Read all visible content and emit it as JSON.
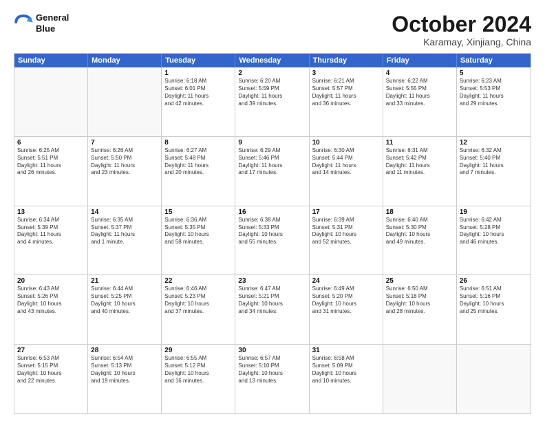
{
  "logo": {
    "line1": "General",
    "line2": "Blue"
  },
  "title": "October 2024",
  "subtitle": "Karamay, Xinjiang, China",
  "header": {
    "days": [
      "Sunday",
      "Monday",
      "Tuesday",
      "Wednesday",
      "Thursday",
      "Friday",
      "Saturday"
    ]
  },
  "rows": [
    [
      {
        "day": "",
        "empty": true
      },
      {
        "day": "",
        "empty": true
      },
      {
        "day": "1",
        "lines": [
          "Sunrise: 6:18 AM",
          "Sunset: 6:01 PM",
          "Daylight: 11 hours",
          "and 42 minutes."
        ]
      },
      {
        "day": "2",
        "lines": [
          "Sunrise: 6:20 AM",
          "Sunset: 5:59 PM",
          "Daylight: 11 hours",
          "and 39 minutes."
        ]
      },
      {
        "day": "3",
        "lines": [
          "Sunrise: 6:21 AM",
          "Sunset: 5:57 PM",
          "Daylight: 11 hours",
          "and 36 minutes."
        ]
      },
      {
        "day": "4",
        "lines": [
          "Sunrise: 6:22 AM",
          "Sunset: 5:55 PM",
          "Daylight: 11 hours",
          "and 33 minutes."
        ]
      },
      {
        "day": "5",
        "lines": [
          "Sunrise: 6:23 AM",
          "Sunset: 5:53 PM",
          "Daylight: 11 hours",
          "and 29 minutes."
        ]
      }
    ],
    [
      {
        "day": "6",
        "lines": [
          "Sunrise: 6:25 AM",
          "Sunset: 5:51 PM",
          "Daylight: 11 hours",
          "and 26 minutes."
        ]
      },
      {
        "day": "7",
        "lines": [
          "Sunrise: 6:26 AM",
          "Sunset: 5:50 PM",
          "Daylight: 11 hours",
          "and 23 minutes."
        ]
      },
      {
        "day": "8",
        "lines": [
          "Sunrise: 6:27 AM",
          "Sunset: 5:48 PM",
          "Daylight: 11 hours",
          "and 20 minutes."
        ]
      },
      {
        "day": "9",
        "lines": [
          "Sunrise: 6:29 AM",
          "Sunset: 5:46 PM",
          "Daylight: 11 hours",
          "and 17 minutes."
        ]
      },
      {
        "day": "10",
        "lines": [
          "Sunrise: 6:30 AM",
          "Sunset: 5:44 PM",
          "Daylight: 11 hours",
          "and 14 minutes."
        ]
      },
      {
        "day": "11",
        "lines": [
          "Sunrise: 6:31 AM",
          "Sunset: 5:42 PM",
          "Daylight: 11 hours",
          "and 11 minutes."
        ]
      },
      {
        "day": "12",
        "lines": [
          "Sunrise: 6:32 AM",
          "Sunset: 5:40 PM",
          "Daylight: 11 hours",
          "and 7 minutes."
        ]
      }
    ],
    [
      {
        "day": "13",
        "lines": [
          "Sunrise: 6:34 AM",
          "Sunset: 5:39 PM",
          "Daylight: 11 hours",
          "and 4 minutes."
        ]
      },
      {
        "day": "14",
        "lines": [
          "Sunrise: 6:35 AM",
          "Sunset: 5:37 PM",
          "Daylight: 11 hours",
          "and 1 minute."
        ]
      },
      {
        "day": "15",
        "lines": [
          "Sunrise: 6:36 AM",
          "Sunset: 5:35 PM",
          "Daylight: 10 hours",
          "and 58 minutes."
        ]
      },
      {
        "day": "16",
        "lines": [
          "Sunrise: 6:38 AM",
          "Sunset: 5:33 PM",
          "Daylight: 10 hours",
          "and 55 minutes."
        ]
      },
      {
        "day": "17",
        "lines": [
          "Sunrise: 6:39 AM",
          "Sunset: 5:31 PM",
          "Daylight: 10 hours",
          "and 52 minutes."
        ]
      },
      {
        "day": "18",
        "lines": [
          "Sunrise: 6:40 AM",
          "Sunset: 5:30 PM",
          "Daylight: 10 hours",
          "and 49 minutes."
        ]
      },
      {
        "day": "19",
        "lines": [
          "Sunrise: 6:42 AM",
          "Sunset: 5:28 PM",
          "Daylight: 10 hours",
          "and 46 minutes."
        ]
      }
    ],
    [
      {
        "day": "20",
        "lines": [
          "Sunrise: 6:43 AM",
          "Sunset: 5:26 PM",
          "Daylight: 10 hours",
          "and 43 minutes."
        ]
      },
      {
        "day": "21",
        "lines": [
          "Sunrise: 6:44 AM",
          "Sunset: 5:25 PM",
          "Daylight: 10 hours",
          "and 40 minutes."
        ]
      },
      {
        "day": "22",
        "lines": [
          "Sunrise: 6:46 AM",
          "Sunset: 5:23 PM",
          "Daylight: 10 hours",
          "and 37 minutes."
        ]
      },
      {
        "day": "23",
        "lines": [
          "Sunrise: 6:47 AM",
          "Sunset: 5:21 PM",
          "Daylight: 10 hours",
          "and 34 minutes."
        ]
      },
      {
        "day": "24",
        "lines": [
          "Sunrise: 6:49 AM",
          "Sunset: 5:20 PM",
          "Daylight: 10 hours",
          "and 31 minutes."
        ]
      },
      {
        "day": "25",
        "lines": [
          "Sunrise: 6:50 AM",
          "Sunset: 5:18 PM",
          "Daylight: 10 hours",
          "and 28 minutes."
        ]
      },
      {
        "day": "26",
        "lines": [
          "Sunrise: 6:51 AM",
          "Sunset: 5:16 PM",
          "Daylight: 10 hours",
          "and 25 minutes."
        ]
      }
    ],
    [
      {
        "day": "27",
        "lines": [
          "Sunrise: 6:53 AM",
          "Sunset: 5:15 PM",
          "Daylight: 10 hours",
          "and 22 minutes."
        ]
      },
      {
        "day": "28",
        "lines": [
          "Sunrise: 6:54 AM",
          "Sunset: 5:13 PM",
          "Daylight: 10 hours",
          "and 19 minutes."
        ]
      },
      {
        "day": "29",
        "lines": [
          "Sunrise: 6:55 AM",
          "Sunset: 5:12 PM",
          "Daylight: 10 hours",
          "and 16 minutes."
        ]
      },
      {
        "day": "30",
        "lines": [
          "Sunrise: 6:57 AM",
          "Sunset: 5:10 PM",
          "Daylight: 10 hours",
          "and 13 minutes."
        ]
      },
      {
        "day": "31",
        "lines": [
          "Sunrise: 6:58 AM",
          "Sunset: 5:09 PM",
          "Daylight: 10 hours",
          "and 10 minutes."
        ]
      },
      {
        "day": "",
        "empty": true
      },
      {
        "day": "",
        "empty": true
      }
    ]
  ]
}
